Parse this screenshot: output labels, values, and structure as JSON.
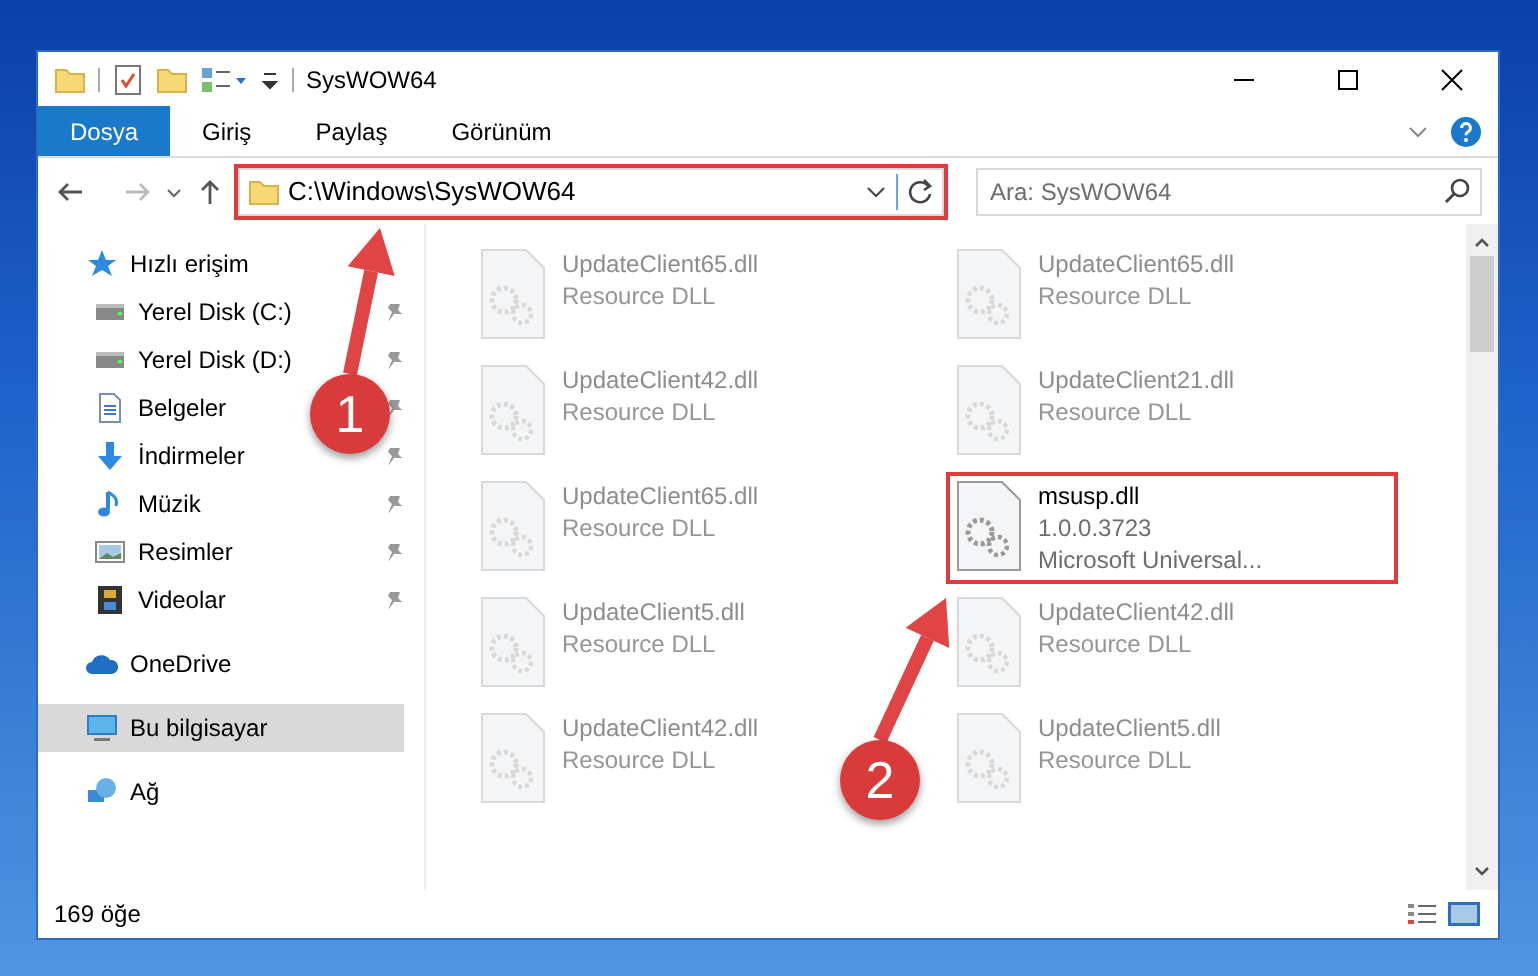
{
  "window": {
    "title": "SysWOW64"
  },
  "ribbon_tabs": [
    {
      "label": "Dosya",
      "selected": true
    },
    {
      "label": "Giriş",
      "selected": false
    },
    {
      "label": "Paylaş",
      "selected": false
    },
    {
      "label": "Görünüm",
      "selected": false
    }
  ],
  "address_bar": {
    "path": "C:\\Windows\\SysWOW64",
    "highlighted": true
  },
  "search": {
    "placeholder": "Ara: SysWOW64"
  },
  "sidebar": {
    "items": [
      {
        "label": "Hızlı erişim",
        "kind": "star",
        "selected": false,
        "children": [
          {
            "label": "Yerel Disk (C:)",
            "kind": "drive",
            "pinned": true
          },
          {
            "label": "Yerel Disk (D:)",
            "kind": "drive",
            "pinned": true
          },
          {
            "label": "Belgeler",
            "kind": "document",
            "pinned": true
          },
          {
            "label": "İndirmeler",
            "kind": "download",
            "pinned": true
          },
          {
            "label": "Müzik",
            "kind": "music",
            "pinned": true
          },
          {
            "label": "Resimler",
            "kind": "picture",
            "pinned": true
          },
          {
            "label": "Videolar",
            "kind": "video",
            "pinned": true
          }
        ]
      },
      {
        "label": "OneDrive",
        "kind": "cloud",
        "selected": false
      },
      {
        "label": "Bu bilgisayar",
        "kind": "computer",
        "selected": true
      },
      {
        "label": "Ağ",
        "kind": "network",
        "selected": false
      }
    ]
  },
  "files": [
    {
      "lines": [
        "UpdateClient65.dll",
        "Resource DLL"
      ],
      "dimmed": true,
      "highlighted": false
    },
    {
      "lines": [
        "UpdateClient65.dll",
        "Resource DLL"
      ],
      "dimmed": true,
      "highlighted": false
    },
    {
      "lines": [
        "UpdateClient42.dll",
        "Resource DLL"
      ],
      "dimmed": true,
      "highlighted": false
    },
    {
      "lines": [
        "UpdateClient21.dll",
        "Resource DLL"
      ],
      "dimmed": true,
      "highlighted": false
    },
    {
      "lines": [
        "UpdateClient65.dll",
        "Resource DLL"
      ],
      "dimmed": true,
      "highlighted": false
    },
    {
      "lines": [
        "msusp.dll",
        "1.0.0.3723",
        "Microsoft Universal..."
      ],
      "dimmed": false,
      "highlighted": true
    },
    {
      "lines": [
        "UpdateClient5.dll",
        "Resource DLL"
      ],
      "dimmed": true,
      "highlighted": false
    },
    {
      "lines": [
        "UpdateClient42.dll",
        "Resource DLL"
      ],
      "dimmed": true,
      "highlighted": false
    },
    {
      "lines": [
        "UpdateClient42.dll",
        "Resource DLL"
      ],
      "dimmed": true,
      "highlighted": false
    },
    {
      "lines": [
        "UpdateClient5.dll",
        "Resource DLL"
      ],
      "dimmed": true,
      "highlighted": false
    }
  ],
  "status_bar": {
    "item_count": "169 öğe"
  },
  "annotations": [
    {
      "label": "1"
    },
    {
      "label": "2"
    }
  ]
}
